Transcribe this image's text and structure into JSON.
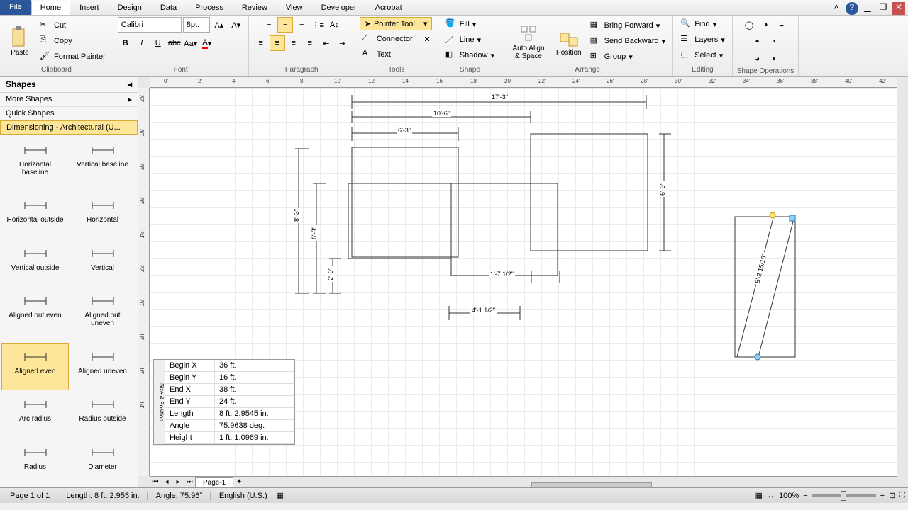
{
  "tabs": {
    "file": "File",
    "home": "Home",
    "insert": "Insert",
    "design": "Design",
    "data": "Data",
    "process": "Process",
    "review": "Review",
    "view": "View",
    "developer": "Developer",
    "acrobat": "Acrobat"
  },
  "ribbon": {
    "clipboard": {
      "label": "Clipboard",
      "paste": "Paste",
      "cut": "Cut",
      "copy": "Copy",
      "format_painter": "Format Painter"
    },
    "font": {
      "label": "Font",
      "family": "Calibri",
      "size": "8pt."
    },
    "paragraph": {
      "label": "Paragraph"
    },
    "tools": {
      "label": "Tools",
      "pointer": "Pointer Tool",
      "connector": "Connector",
      "text": "Text"
    },
    "shape": {
      "label": "Shape",
      "fill": "Fill",
      "line": "Line",
      "shadow": "Shadow"
    },
    "arrange": {
      "label": "Arrange",
      "auto_align": "Auto Align & Space",
      "position": "Position",
      "bring_forward": "Bring Forward",
      "send_backward": "Send Backward",
      "group": "Group"
    },
    "editing": {
      "label": "Editing",
      "find": "Find",
      "layers": "Layers",
      "select": "Select"
    },
    "shape_ops": {
      "label": "Shape Operations"
    }
  },
  "shapes_panel": {
    "title": "Shapes",
    "more_shapes": "More Shapes",
    "quick_shapes": "Quick Shapes",
    "stencil": "Dimensioning - Architectural (U...",
    "items": [
      "Horizontal baseline",
      "Vertical baseline",
      "Horizontal outside",
      "Horizontal",
      "Vertical outside",
      "Vertical",
      "Aligned out even",
      "Aligned out uneven",
      "Aligned even",
      "Aligned uneven",
      "Arc radius",
      "Radius outside",
      "Radius",
      "Diameter"
    ],
    "selected_index": 8
  },
  "drawing": {
    "dims": {
      "d1": "17'-3\"",
      "d2": "10'-6\"",
      "d3": "6'-3\"",
      "d4": "8'-3\"",
      "d5": "6'-3\"",
      "d6": "2'-0\"",
      "d7": "1'-7 1/2\"",
      "d8": "4'-1 1/2\"",
      "d9": "6'-9\"",
      "d10": "8'-2 15/16\""
    }
  },
  "size_position": {
    "title": "Size & Position",
    "rows": [
      {
        "label": "Begin X",
        "value": "36 ft."
      },
      {
        "label": "Begin Y",
        "value": "16 ft."
      },
      {
        "label": "End X",
        "value": "38 ft."
      },
      {
        "label": "End Y",
        "value": "24 ft."
      },
      {
        "label": "Length",
        "value": "8 ft. 2.9545 in."
      },
      {
        "label": "Angle",
        "value": "75.9638 deg."
      },
      {
        "label": "Height",
        "value": "1 ft. 1.0969 in."
      }
    ]
  },
  "page_tabs": {
    "page1": "Page-1"
  },
  "status": {
    "page": "Page 1 of 1",
    "length": "Length: 8 ft. 2.955 in.",
    "angle": "Angle: 75.96°",
    "lang": "English (U.S.)",
    "zoom": "100%"
  },
  "ruler_h": [
    "0'",
    "2'",
    "4'",
    "6'",
    "8'",
    "10'",
    "12'",
    "14'",
    "16'",
    "18'",
    "20'",
    "22'",
    "24'",
    "26'",
    "28'",
    "30'",
    "32'",
    "34'",
    "36'",
    "38'",
    "40'",
    "42'"
  ],
  "ruler_v": [
    "32'",
    "30'",
    "28'",
    "26'",
    "24'",
    "22'",
    "20'",
    "18'",
    "16'",
    "14'"
  ]
}
